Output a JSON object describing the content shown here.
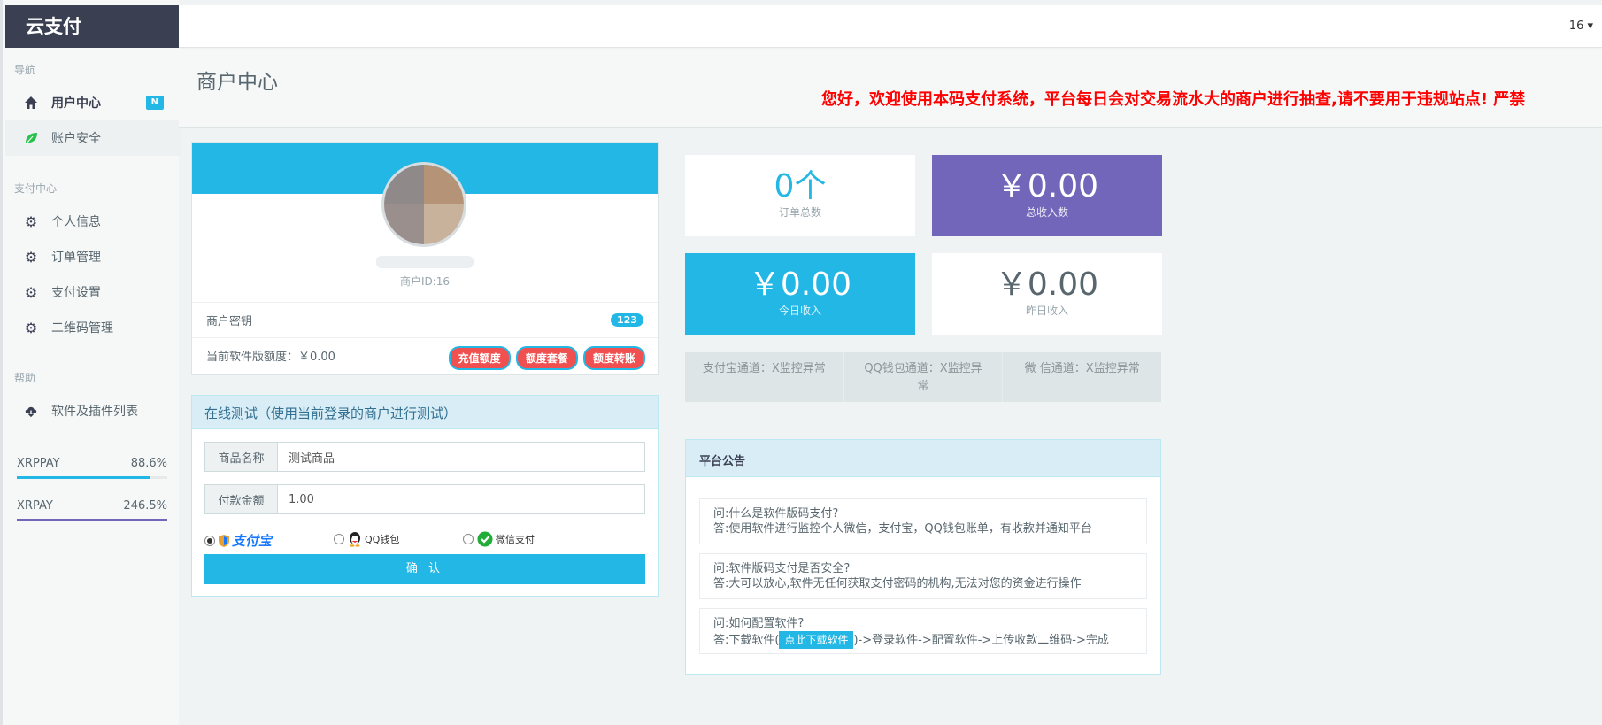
{
  "brand": "云支付",
  "header": {
    "user_label": "16 ▾"
  },
  "sidebar": {
    "sections": [
      "导航",
      "支付中心",
      "帮助"
    ],
    "items": [
      {
        "label": "用户中心",
        "icon": "home-icon",
        "badge": "N"
      },
      {
        "label": "账户安全",
        "icon": "leaf-icon"
      },
      {
        "label": "个人信息",
        "icon": "gear-icon"
      },
      {
        "label": "订单管理",
        "icon": "gear-icon"
      },
      {
        "label": "支付设置",
        "icon": "gear-icon"
      },
      {
        "label": "二维码管理",
        "icon": "gear-icon"
      },
      {
        "label": "软件及插件列表",
        "icon": "cloud-download-icon"
      }
    ],
    "progress": [
      {
        "name": "XRPPAY",
        "value": "88.6%",
        "fraction": 0.886,
        "color": "#23b7e5"
      },
      {
        "name": "XRPAY",
        "value": "246.5%",
        "fraction": 1.0,
        "color": "#7266ba"
      }
    ]
  },
  "page": {
    "title": "商户中心",
    "announcement": "您好，欢迎使用本码支付系统，平台每日会对交易流水大的商户进行抽查,请不要用于违规站点! 严禁"
  },
  "profile": {
    "merchant_id": "商户ID:16",
    "key_label": "商户密钥",
    "key_badge": "123",
    "quota_label": "当前软件版额度：￥0.00",
    "buttons": [
      "充值额度",
      "额度套餐",
      "额度转账"
    ]
  },
  "test": {
    "title": "在线测试（使用当前登录的商户进行测试）",
    "product_label": "商品名称",
    "product_value": "测试商品",
    "amount_label": "付款金额",
    "amount_value": "1.00",
    "methods": [
      "支付宝",
      "QQ钱包",
      "微信支付"
    ],
    "selected_method": "支付宝",
    "confirm_label": "确 认"
  },
  "stats": [
    {
      "value": "0个",
      "label": "订单总数",
      "bg": "#ffffff",
      "color": "#23b7e5"
    },
    {
      "value": "￥0.00",
      "label": "总收入数",
      "bg": "#7266ba",
      "color": "#ffffff"
    },
    {
      "value": "￥0.00",
      "label": "今日收入",
      "bg": "#23b7e5",
      "color": "#ffffff"
    },
    {
      "value": "￥0.00",
      "label": "昨日收入",
      "bg": "#ffffff",
      "color": "#58666e"
    }
  ],
  "channels": [
    "支付宝通道：X监控异常",
    "QQ钱包通道：X监控异常",
    "微 信通道：X监控异常"
  ],
  "notice": {
    "title": "平台公告",
    "faqs": [
      {
        "q": "问:什么是软件版码支付?",
        "a": "答:使用软件进行监控个人微信，支付宝，QQ钱包账单，有收款并通知平台"
      },
      {
        "q": "问:软件版码支付是否安全?",
        "a": "答:大可以放心,软件无任何获取支付密码的机构,无法对您的资金进行操作"
      },
      {
        "q": "问:如何配置软件?",
        "a_prefix": "答:下载软件(",
        "a_link": "点此下载软件",
        "a_suffix": ")->登录软件->配置软件->上传收款二维码->完成"
      }
    ]
  }
}
